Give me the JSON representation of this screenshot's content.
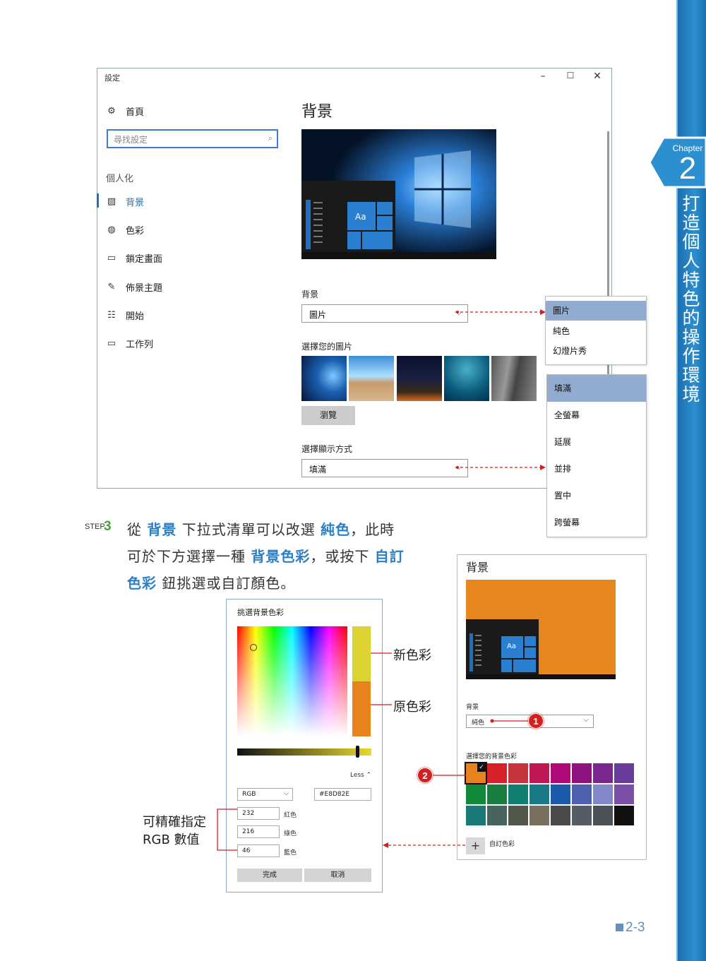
{
  "chapter": {
    "word": "Chapter",
    "number": "2",
    "title": "打造個人特色的操作環境"
  },
  "window": {
    "title": "設定",
    "controls": [
      "–",
      "☐",
      "✕"
    ],
    "home": "首頁",
    "search_placeholder": "尋找設定",
    "section": "個人化",
    "nav": [
      {
        "label": "背景",
        "icon": "picture-icon"
      },
      {
        "label": "色彩",
        "icon": "palette-icon"
      },
      {
        "label": "鎖定畫面",
        "icon": "lock-screen-icon"
      },
      {
        "label": "佈景主題",
        "icon": "theme-icon"
      },
      {
        "label": "開始",
        "icon": "start-icon"
      },
      {
        "label": "工作列",
        "icon": "taskbar-icon"
      }
    ],
    "heading": "背景",
    "preview_tile": "Aa",
    "bg_label": "背景",
    "bg_value": "圖片",
    "choose_picture": "選擇您的圖片",
    "browse": "瀏覽",
    "fit_label": "選擇顯示方式",
    "fit_value": "填滿"
  },
  "bg_options": [
    "圖片",
    "純色",
    "幻燈片秀"
  ],
  "fit_options": [
    "填滿",
    "全螢幕",
    "延展",
    "並排",
    "置中",
    "跨螢幕"
  ],
  "step": {
    "label": "STEP",
    "number": "3",
    "line1": [
      "從 ",
      "背景",
      " 下拉式清單可以改選 ",
      "純色",
      "，此時"
    ],
    "line2": [
      "可於下方選擇一種 ",
      "背景色彩",
      "，或按下 ",
      "自訂"
    ],
    "line3": [
      "色彩",
      " 鈕挑選或自訂顏色。"
    ]
  },
  "picker": {
    "title": "挑選背景色彩",
    "new_color": "新色彩",
    "old_color": "原色彩",
    "less": "Less",
    "mode": "RGB",
    "hex": "#E8D82E",
    "r": "232",
    "r_label": "紅色",
    "g": "216",
    "g_label": "綠色",
    "b": "46",
    "b_label": "藍色",
    "done": "完成",
    "cancel": "取消",
    "callout": [
      "可精確指定",
      "RGB 數值"
    ]
  },
  "panel": {
    "heading": "背景",
    "preview_tile": "Aa",
    "bg_label": "背景",
    "bg_value": "純色",
    "choose_color": "選擇您的背景色彩",
    "custom": "自訂色彩",
    "badge1": "1",
    "badge2": "2",
    "colors": [
      "#e8821e",
      "#d8202a",
      "#c8343c",
      "#c01855",
      "#b00a78",
      "#8e1280",
      "#7a2890",
      "#6a3c9c",
      "#108a3a",
      "#1a7e40",
      "#128070",
      "#1a7a8a",
      "#1a5aa8",
      "#5060b0",
      "#8088c8",
      "#7a50a8",
      "#1a7a78",
      "#48645e",
      "#52584a",
      "#7a7060",
      "#4a4a48",
      "#545c66",
      "#4a5258",
      "#111111"
    ]
  },
  "page_number": "2-3"
}
